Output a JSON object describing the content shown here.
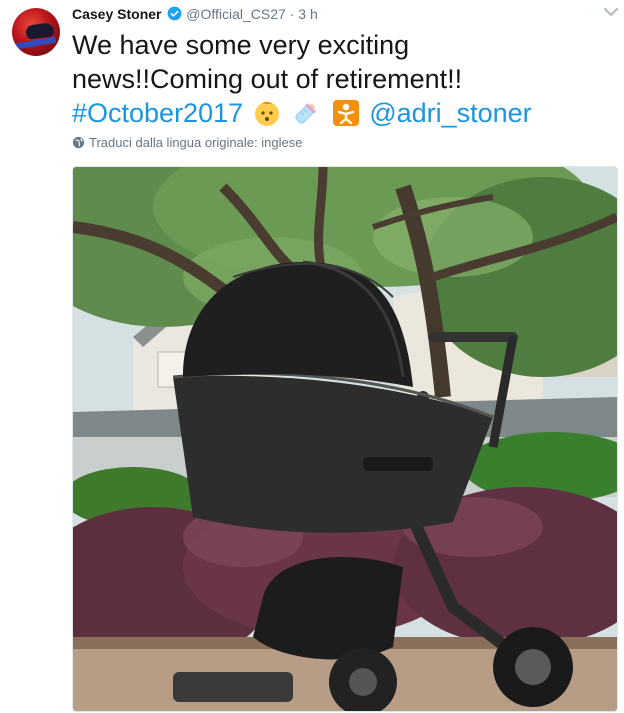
{
  "tweet": {
    "author_name": "Casey Stoner",
    "handle": "@Official_CS27",
    "separator": "·",
    "time": "3 h",
    "text_line1": "We have some very exciting",
    "text_line2": "news!!Coming out of retirement!!",
    "hashtag": "#October2017",
    "mention": "@adri_stoner",
    "emojis": [
      "baby-face-icon",
      "baby-bottle-icon",
      "baby-symbol-icon"
    ],
    "translate_label": "Traduci dalla lingua originale: inglese"
  },
  "colors": {
    "link": "#1b95e0",
    "verified": "#1da1f2",
    "muted": "#657786"
  }
}
